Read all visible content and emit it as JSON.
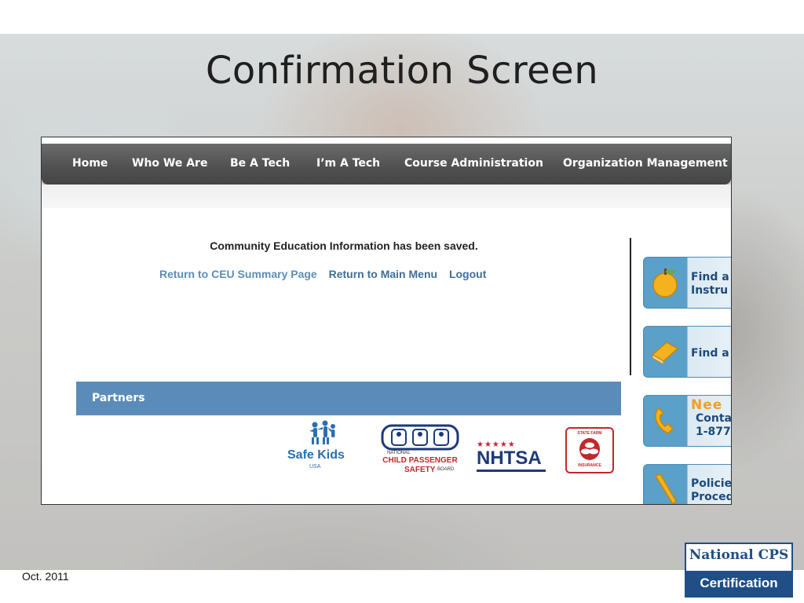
{
  "slide": {
    "title": "Confirmation Screen",
    "footer_date": "Oct. 2011",
    "logo": {
      "top": "National CPS",
      "bottom": "Certification"
    }
  },
  "nav": {
    "items": [
      "Home",
      "Who We Are",
      "Be A Tech",
      "I’m A Tech",
      "Course Administration",
      "Organization Management"
    ]
  },
  "main": {
    "message": "Community Education Information has been saved.",
    "links": [
      "Return to CEU Summary Page",
      "Return to Main Menu",
      "Logout"
    ]
  },
  "partners": {
    "label": "Partners",
    "safe_kids": {
      "name": "Safe Kids",
      "sub": "USA"
    },
    "cps_board": {
      "national": "NATIONAL",
      "line1": "CHILD PASSENGER",
      "line2": "SAFETY",
      "board": "BOARD"
    },
    "nhtsa": {
      "stars": "★★★★★",
      "name": "NHTSA"
    },
    "state_farm": {
      "top": "STATE FARM",
      "bottom": "INSURANCE"
    }
  },
  "sidebar": {
    "buttons": [
      {
        "line1": "Find a",
        "line2": "Instru"
      },
      {
        "line1": "Find a",
        "line2": ""
      },
      {
        "line1": "Nee",
        "line2": "Conta",
        "line3": "1-877"
      },
      {
        "line1": "Policie",
        "line2": "Proced"
      }
    ]
  },
  "colors": {
    "nav_bg": "#525252",
    "partners_bar": "#5b8cb9",
    "link_light": "#5b8db8",
    "link_dark": "#3f6f99",
    "sidebar_accent": "#5aa0c8",
    "cert_blue": "#1f4f86"
  }
}
